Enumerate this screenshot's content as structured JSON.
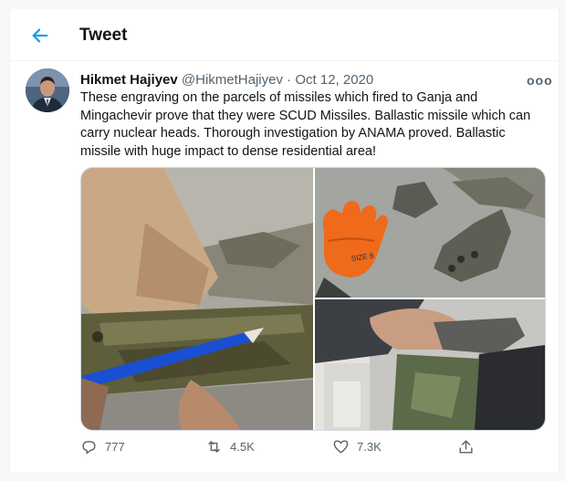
{
  "header": {
    "title": "Tweet",
    "back_icon": "arrow-left-icon"
  },
  "tweet": {
    "author_name": "Hikmet Hajiyev",
    "handle": "@HikmetHajiyev",
    "separator": "·",
    "date": "Oct 12, 2020",
    "more_label": "ooo",
    "text": "These engraving on the parcels of missiles which fired to Ganja and Mingachevir prove that they were SCUD Missiles. Ballastic missile which can carry nuclear heads. Thorough investigation by ANAMA proved. Ballastic missile with huge impact to dense residential area!",
    "photos": [
      {
        "name": "photo-engraved-fragment-with-pen"
      },
      {
        "name": "photo-debris-with-orange-glove"
      },
      {
        "name": "photo-hand-holding-fragment"
      }
    ],
    "glove_text": "SIZE 9",
    "replies": "777",
    "retweets": "4.5K",
    "likes": "7.3K"
  },
  "colors": {
    "accent": "#1d9bf0",
    "text": "#0f1419",
    "muted": "#536471",
    "border": "#eff3f4"
  }
}
